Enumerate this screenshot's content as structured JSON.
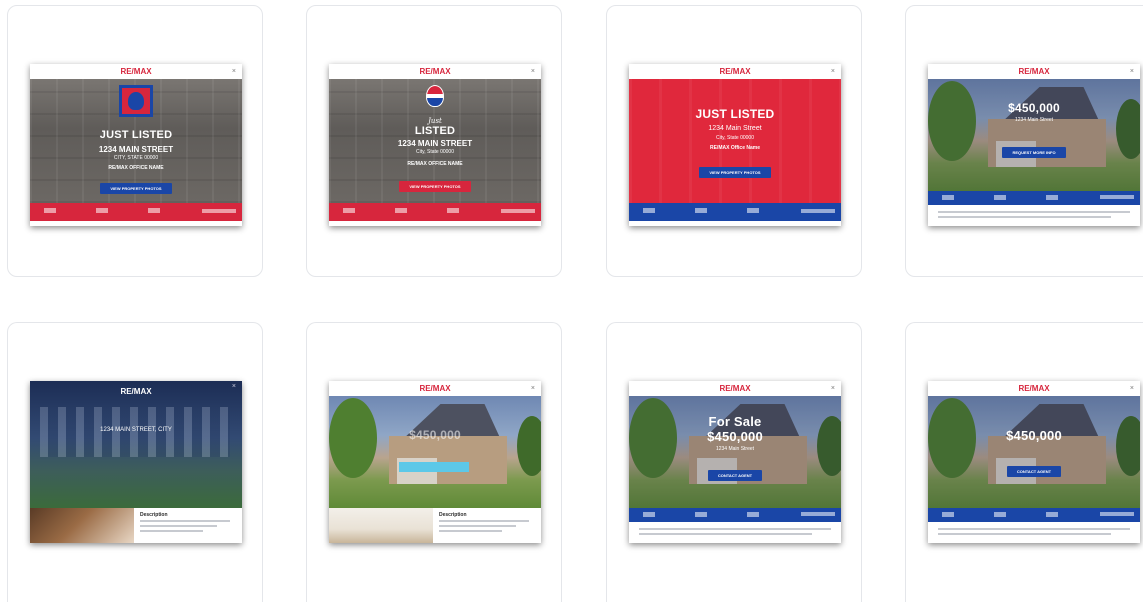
{
  "templates": [
    {
      "brand": "RE/MAX",
      "close": "×",
      "headline": "JUST LISTED",
      "address": "1234 MAIN STREET",
      "city": "CITY, STATE 00000",
      "office": "RE/MAX OFFICE NAME",
      "button": "VIEW PROPERTY PHOTOS"
    },
    {
      "brand": "RE/MAX",
      "close": "×",
      "headline_script": "Just",
      "headline": "LISTED",
      "address": "1234 MAIN STREET",
      "city": "City, State 00000",
      "office": "RE/MAX OFFICE NAME",
      "button": "VIEW PROPERTY PHOTOS"
    },
    {
      "brand": "RE/MAX",
      "close": "×",
      "headline": "JUST LISTED",
      "address": "1234 Main Street",
      "city": "City, State 00000",
      "office": "RE/MAX Office Name",
      "button": "VIEW PROPERTY PHOTOS"
    },
    {
      "brand": "RE/MAX",
      "close": "×",
      "price": "$450,000",
      "address": "1234 Main Street",
      "button": "REQUEST MORE INFO"
    },
    {
      "brand": "RE/MAX",
      "close": "×",
      "address": "1234 MAIN STREET, CITY",
      "desc_title": "Description"
    },
    {
      "brand": "RE/MAX",
      "close": "×",
      "price": "$450,000",
      "desc_title": "Description"
    },
    {
      "brand": "RE/MAX",
      "close": "×",
      "headline": "For Sale",
      "price": "$450,000",
      "address": "1234 Main Street",
      "button": "CONTACT AGENT"
    },
    {
      "brand": "RE/MAX",
      "close": "×",
      "price": "$450,000",
      "button": "CONTACT AGENT"
    }
  ],
  "colors": {
    "remax_red": "#d7263d",
    "remax_blue": "#1a46a7"
  }
}
